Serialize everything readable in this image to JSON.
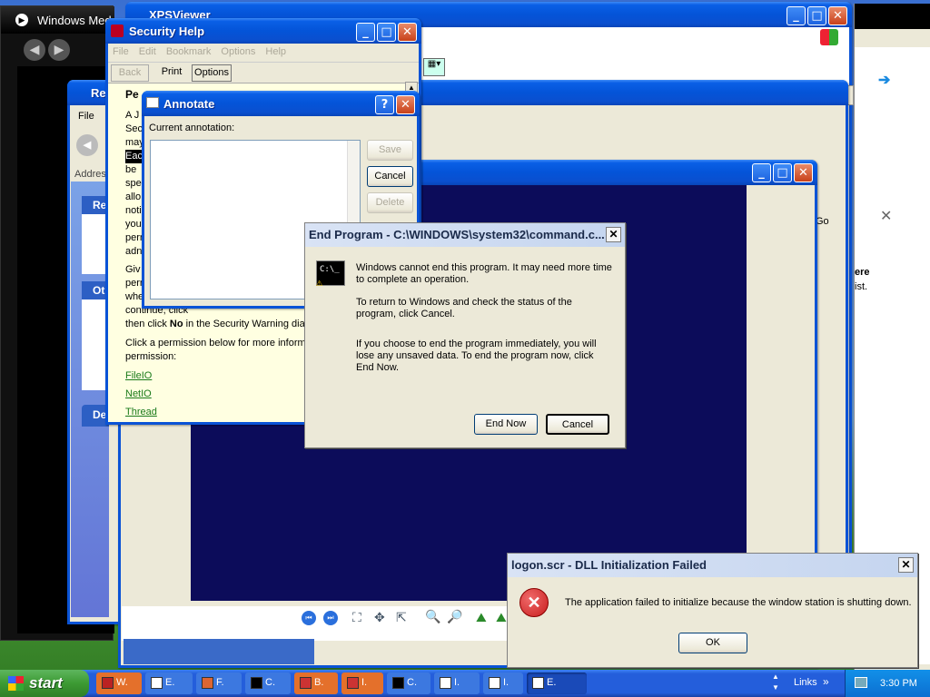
{
  "colors": {
    "xp_blue": "#0a53d6",
    "taskbar": "#245edb",
    "start_green": "#3c9a33",
    "error_red": "#c81e1e",
    "annot_yellow": "#ffffe1",
    "viewer_navy": "#0c0c5a"
  },
  "media_player": {
    "title": "Windows Med"
  },
  "xps_viewer": {
    "title": "XPSViewer"
  },
  "ie_window": {
    "go_label": "Go"
  },
  "explorer_window": {
    "menu_file": "File",
    "address_label": "Address",
    "panel_headers": [
      "Re",
      "Ot",
      "De"
    ],
    "go_label": "Go",
    "right_text_1": "ere",
    "right_text_2": "ist."
  },
  "security_help": {
    "title": "Security Help",
    "menu": [
      "File",
      "Edit",
      "Bookmark",
      "Options",
      "Help"
    ],
    "toolbar": {
      "back": "Back",
      "print": "Print",
      "options": "Options"
    },
    "heading_frag": "Pe",
    "body_frags": [
      "A J",
      "Sec",
      "may",
      "Eac",
      "be",
      "spe",
      "allo",
      "noti",
      "you",
      "perr",
      "adn",
      "Giv",
      "perr",
      "whe",
      "continue, click"
    ],
    "line_no": "then click ",
    "line_no_bold": "No",
    "line_no_end": " in the Security Warning dia",
    "perm_line1": "Click a permission below for more informat",
    "perm_line2": "permission:",
    "links": [
      "FileIO",
      "NetIO",
      "Thread"
    ]
  },
  "annotate": {
    "title": "Annotate",
    "label": "Current annotation:",
    "save": "Save",
    "cancel": "Cancel",
    "delete": "Delete"
  },
  "end_program": {
    "title": "End Program - C:\\WINDOWS\\system32\\command.c...",
    "msg1": "Windows cannot end this program. It may need more time to complete an operation.",
    "msg2": "To return to Windows and check the status of the program, click Cancel.",
    "msg3": "If you choose to end the program immediately, you will lose any unsaved data. To end the program now, click End Now.",
    "end_now": "End Now",
    "cancel": "Cancel"
  },
  "logon_error": {
    "title": "logon.scr - DLL Initialization Failed",
    "message": "The application failed to initialize because the window station is shutting down.",
    "ok": "OK"
  },
  "taskbar": {
    "start": "start",
    "buttons": [
      {
        "label": "W.",
        "icon": "media-player-icon"
      },
      {
        "label": "E.",
        "icon": "window-icon"
      },
      {
        "label": "F.",
        "icon": "folder-icon"
      },
      {
        "label": "C.",
        "icon": "command-prompt-icon"
      },
      {
        "label": "B.",
        "icon": "bookmark-icon"
      },
      {
        "label": "I.",
        "icon": "ie-icon"
      },
      {
        "label": "C.",
        "icon": "command-prompt-icon"
      },
      {
        "label": "I.",
        "icon": "window-icon"
      },
      {
        "label": "I.",
        "icon": "window-icon"
      },
      {
        "label": "E.",
        "icon": "window-icon"
      }
    ],
    "links": "Links",
    "clock": "3:30 PM"
  }
}
